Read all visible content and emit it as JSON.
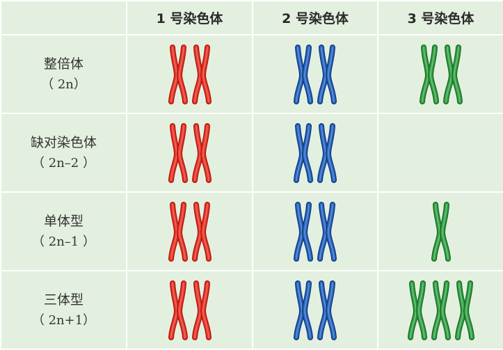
{
  "header": {
    "corner": "",
    "col1": "1 号染色体",
    "col2": "2 号染色体",
    "col3": "3 号染色体"
  },
  "rows": [
    {
      "name": "整倍体",
      "formula": "（ 2n）",
      "counts": [
        2,
        2,
        2
      ]
    },
    {
      "name": "缺对染色体",
      "formula": "（ 2n–2 ）",
      "counts": [
        2,
        2,
        0
      ]
    },
    {
      "name": "单体型",
      "formula": "（ 2n–1 ）",
      "counts": [
        2,
        2,
        1
      ]
    },
    {
      "name": "三体型",
      "formula": "（ 2n+1）",
      "counts": [
        2,
        2,
        3
      ]
    }
  ],
  "colors": {
    "chromosome1": "#e03a2f",
    "chromosome2": "#2f63b3",
    "chromosome3": "#3a9a4a",
    "cell_bg": "#e4f0df"
  }
}
